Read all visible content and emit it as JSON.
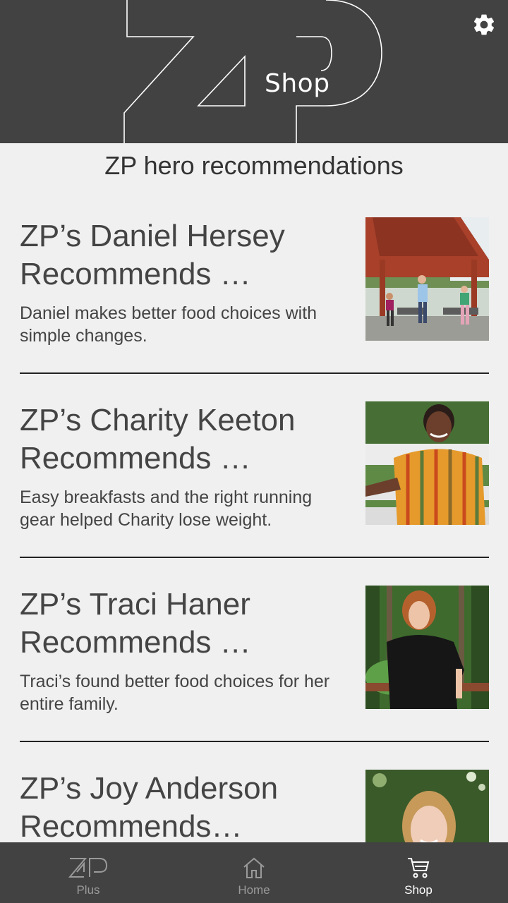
{
  "header": {
    "logo_text": "ZP",
    "logo_subtitle": "Shop",
    "settings_icon": "gear-icon"
  },
  "main": {
    "section_title": "ZP hero recommendations",
    "cards": [
      {
        "title": "ZP’s Daniel Hersey Recommends …",
        "description": "Daniel makes better food choices with simple changes."
      },
      {
        "title": "ZP’s Charity Keeton Recommends …",
        "description": "Easy breakfasts and the right running gear helped Charity lose weight."
      },
      {
        "title": "ZP’s Traci Haner Recommends …",
        "description": "Traci’s found better food choices for her entire family."
      },
      {
        "title": "ZP’s Joy Anderson Recommends…",
        "description": ""
      }
    ]
  },
  "bottom_nav": {
    "items": [
      {
        "label": "Plus",
        "icon": "zp-logo-icon",
        "active": false
      },
      {
        "label": "Home",
        "icon": "home-icon",
        "active": false
      },
      {
        "label": "Shop",
        "icon": "cart-icon",
        "active": true
      }
    ]
  },
  "colors": {
    "header_bg": "#424242",
    "page_bg": "#f0f0f0",
    "nav_inactive": "#9a9a9a",
    "nav_active": "#ffffff"
  }
}
